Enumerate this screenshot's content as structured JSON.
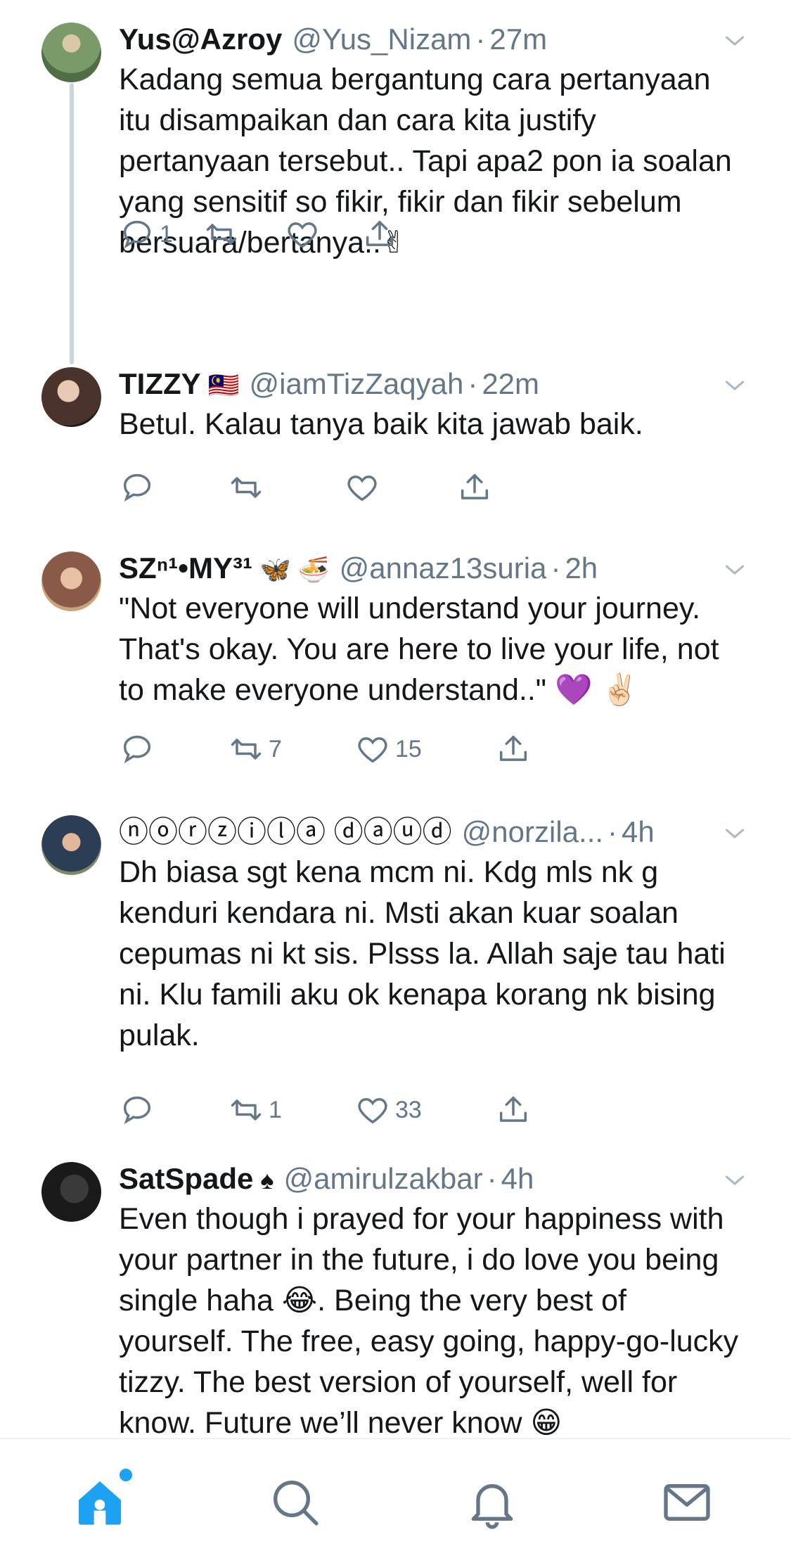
{
  "tweets": [
    {
      "name": "Yus@Azroy",
      "name_emoji": "",
      "handle": "@Yus_Nizam",
      "time": "27m",
      "text": "Kadang semua bergantung cara pertanyaan itu disampaikan dan cara kita justify pertanyaan tersebut..  Tapi apa2 pon ia soalan yang sensitif so fikir, fikir dan fikir sebelum bersuara/bertanya..✌",
      "reply_count": "1",
      "retweet_count": "",
      "like_count": "",
      "avatar_color": "#6b8f5e"
    },
    {
      "name": "TIZZY",
      "name_emoji": "🇲🇾",
      "handle": "@iamTizZaqyah",
      "time": "22m",
      "text": "Betul. Kalau tanya baik kita jawab baik.",
      "reply_count": "",
      "retweet_count": "",
      "like_count": "",
      "avatar_color": "#5a4640"
    },
    {
      "name": "SZⁿ¹•MY³¹",
      "name_emoji": "🦋 🍜",
      "handle": "@annaz13suria",
      "time": "2h",
      "text": "\"Not everyone will understand your journey. That's okay. You are here to live your life, not to make everyone understand..\" 💜 ✌🏻",
      "reply_count": "",
      "retweet_count": "7",
      "like_count": "15",
      "avatar_color": "#a8826e"
    },
    {
      "name": "ⓝⓞⓡⓩⓘⓛⓐ ⓓⓐⓤⓓ",
      "name_emoji": "",
      "handle": "@norzila...",
      "time": "4h",
      "text": "Dh biasa sgt kena mcm ni. Kdg mls nk g kenduri kendara ni. Msti akan kuar soalan cepumas  ni kt sis. Plsss la. Allah saje tau hati ni. Klu famili aku ok kenapa korang nk bising pulak.",
      "reply_count": "",
      "retweet_count": "1",
      "like_count": "33",
      "avatar_color": "#3e4f63"
    },
    {
      "name": "SatSpade",
      "name_emoji": "♠",
      "handle": "@amirulzakbar",
      "time": "4h",
      "text": "Even though i prayed for your happiness with your partner in the future, i do love you being single haha 😂. Being the very best of yourself. The free, easy going, happy-go-lucky tizzy. The best version of yourself, well for know. Future we’ll never know 😁",
      "reply_count": "",
      "retweet_count": "",
      "like_count": "",
      "avatar_color": "#2a2a2a"
    }
  ],
  "colors": {
    "accent": "#1da1f2",
    "icon_gray": "#657786",
    "text": "#14171a",
    "thread_line": "#ccd6dd"
  },
  "tabs": [
    {
      "icon": "home-icon",
      "active": true
    },
    {
      "icon": "search-icon",
      "active": false
    },
    {
      "icon": "bell-icon",
      "active": false
    },
    {
      "icon": "mail-icon",
      "active": false
    }
  ]
}
